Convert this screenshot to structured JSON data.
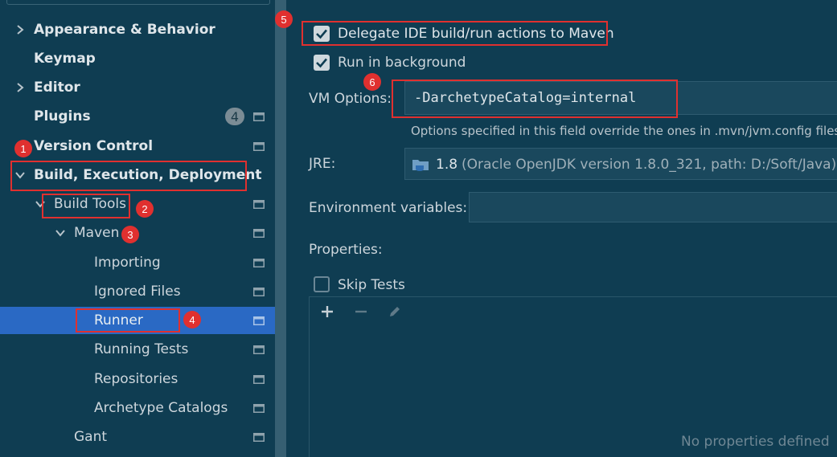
{
  "sidebar": {
    "items": [
      {
        "label": "Appearance & Behavior"
      },
      {
        "label": "Keymap"
      },
      {
        "label": "Editor"
      },
      {
        "label": "Plugins",
        "badge": "4"
      },
      {
        "label": "Version Control"
      },
      {
        "label": "Build, Execution, Deployment"
      },
      {
        "label": "Build Tools"
      },
      {
        "label": "Maven"
      },
      {
        "label": "Importing"
      },
      {
        "label": "Ignored Files"
      },
      {
        "label": "Runner",
        "selected": true
      },
      {
        "label": "Running Tests"
      },
      {
        "label": "Repositories"
      },
      {
        "label": "Archetype Catalogs"
      },
      {
        "label": "Gant"
      }
    ]
  },
  "markers": [
    "1",
    "2",
    "3",
    "4",
    "5",
    "6"
  ],
  "runner": {
    "delegate": {
      "label": "Delegate IDE build/run actions to Maven",
      "checked": true
    },
    "background": {
      "label": "Run in background",
      "checked": true
    },
    "vm_options": {
      "label": "VM Options:",
      "value": "-DarchetypeCatalog=internal",
      "hint": "Options specified in this field override the ones in .mvn/jvm.config files"
    },
    "jre": {
      "label": "JRE:",
      "version": "1.8",
      "detail": "(Oracle OpenJDK version 1.8.0_321, path: D:/Soft/Java)"
    },
    "env": {
      "label": "Environment variables:",
      "value": ""
    },
    "properties": {
      "label": "Properties:",
      "skip_tests": {
        "label": "Skip Tests",
        "checked": false
      },
      "empty_text": "No properties defined"
    }
  },
  "colors": {
    "background": "#0f3d52",
    "selection": "#2a69c4",
    "annotation_red": "#e0302f"
  }
}
